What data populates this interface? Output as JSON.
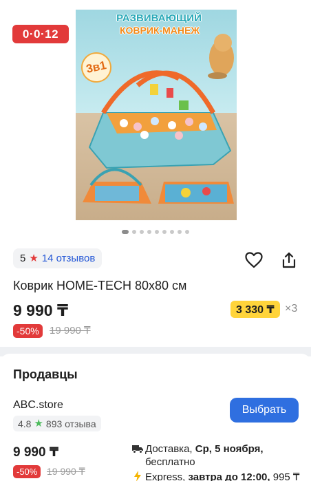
{
  "gallery": {
    "installment_badge": "0·0·12",
    "image": {
      "headline_top": "РАЗВИВАЮЩИЙ",
      "headline_bottom": "КОВРИК-МАНЕЖ",
      "sticker": "3в1"
    },
    "dots_count": 9,
    "active_dot": 0
  },
  "rating": {
    "score": "5",
    "reviews_label": "14 отзывов"
  },
  "product": {
    "title": "Коврик HOME-TECH 80x80 см",
    "price": "9 990 ₸",
    "discount": "-50%",
    "old_price": "19 990 ₸",
    "installment_price": "3 330 ₸",
    "installment_multiplier": "×3"
  },
  "sellers": {
    "heading": "Продавцы",
    "items": [
      {
        "name": "ABC.store",
        "rating": "4.8",
        "reviews": "893 отзыва",
        "choose_label": "Выбрать",
        "price": "9 990 ₸",
        "discount": "-50%",
        "old_price": "19 990 ₸",
        "delivery_prefix": "Доставка, ",
        "delivery_date": "Ср, 5 ноября,",
        "delivery_suffix": "бесплатно",
        "express_prefix": "Express, ",
        "express_time": "завтра до 12:00,",
        "express_price": " 995 ₸"
      }
    ]
  },
  "colors": {
    "accent_red": "#e23a3a",
    "link_blue": "#2457d6",
    "button_blue": "#2f6fe0",
    "installment_yellow": "#ffd43b",
    "star_green": "#4cbb5c"
  },
  "icons": [
    "star-icon",
    "heart-icon",
    "share-icon",
    "truck-icon",
    "bolt-icon"
  ]
}
